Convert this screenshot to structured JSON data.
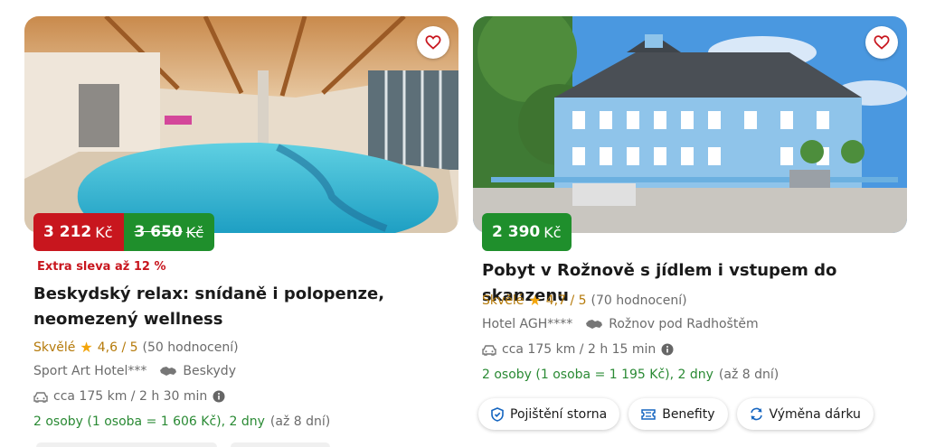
{
  "colors": {
    "red": "#c8161e",
    "green": "#1f8f2c",
    "star": "#f3a50b",
    "rating_word": "#b57a0a"
  },
  "cards": [
    {
      "price_now": "3 212",
      "price_was": "3 650",
      "currency": "Kč",
      "discount": "Extra sleva až 12 %",
      "title_line1": "Beskydský relax: snídaně i polopenze,",
      "title_line2": "neomezený wellness",
      "rating_word": "Skvělé",
      "rating_score": "4,6 / 5",
      "rating_count": "(50 hodnocení)",
      "hotel": "Sport Art Hotel***",
      "location": "Beskydy",
      "distance": "cca 175 km / 2 h 30 min",
      "persons": "2 osoby (1 osoba = 1 606 Kč), 2 dny",
      "persons_hint": "(až 8 dní)",
      "favorite_icon": "heart-icon"
    },
    {
      "price": "2 390",
      "currency": "Kč",
      "title": "Pobyt v Rožnově s jídlem i vstupem do skanzenu",
      "rating_word": "Skvělé",
      "rating_score": "4,7 / 5",
      "rating_count": "(70 hodnocení)",
      "hotel": "Hotel AGH****",
      "location": "Rožnov pod Radhoštěm",
      "distance": "cca 175 km / 2 h 15 min",
      "persons": "2 osoby (1 osoba = 1 195 Kč), 2 dny",
      "persons_hint": "(až 8 dní)",
      "favorite_icon": "heart-icon",
      "tags": [
        {
          "label": "Pojištění storna",
          "icon": "insurance-icon"
        },
        {
          "label": "Benefity",
          "icon": "ticket-icon"
        },
        {
          "label": "Výměna dárku",
          "icon": "exchange-icon"
        }
      ]
    }
  ]
}
